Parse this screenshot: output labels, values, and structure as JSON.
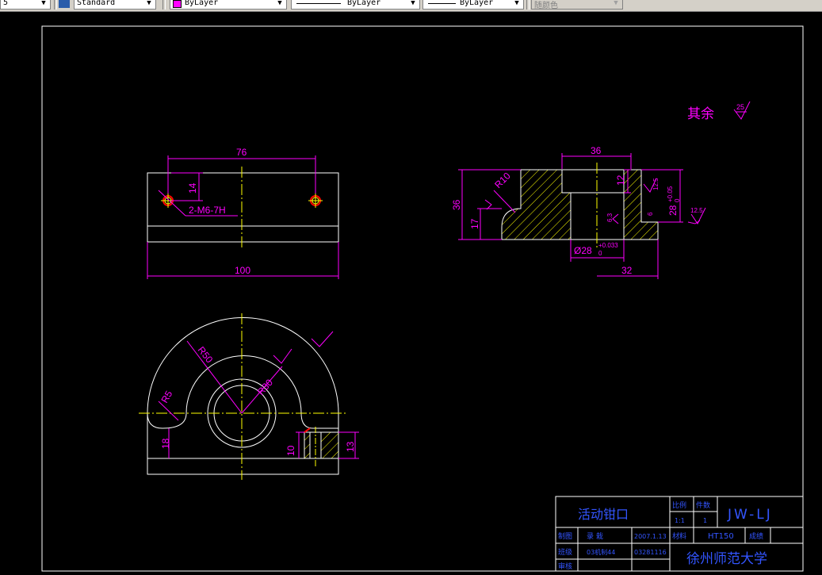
{
  "toolbar": {
    "lineweight_value": "5",
    "textstyle_value": "Standard",
    "layer_color_value": "ByLayer",
    "linetype_value": "ByLayer",
    "lineweight2_value": "ByLayer",
    "plotstyle_value": "随颜色"
  },
  "colors": {
    "background": "#000000",
    "outline": "#ffffff",
    "dimension": "#ff00ff",
    "centerline": "#ffff00",
    "hatch": "#ffff00",
    "titleblock": "#3355ff",
    "hole_marker": "#ff0000"
  },
  "drawing": {
    "surface_note": {
      "label": "其余",
      "roughness": "25"
    },
    "top_view": {
      "dim_width_total": "100",
      "dim_hole_spacing": "76",
      "dim_hole_offset": "14",
      "thread_callout": "2-M6-7H"
    },
    "section_view": {
      "dim_top_width": "36",
      "dim_bore_depth": "12",
      "dim_total_height": "36",
      "dim_step_height": "17",
      "dim_radius": "R10",
      "dim_height_tol_value": "28",
      "dim_height_tol_upper": "+0.05",
      "dim_height_tol_lower": "0",
      "dim_bore_value": "Ø28",
      "dim_bore_upper": "+0.033",
      "dim_bore_lower": "0",
      "dim_base_width": "32",
      "roughness_a": "12.5",
      "roughness_b": "6.3",
      "roughness_c": "12.5",
      "roughness_d": "6"
    },
    "front_view": {
      "dim_outer_radius": "R50",
      "dim_inner_radius": "R30",
      "dim_fillet_radius": "R5",
      "dim_base_height": "18",
      "dim_hole_depth": "10",
      "dim_hatch_height": "13"
    }
  },
  "title_block": {
    "part_name": "活动钳口",
    "scale_header": "比例",
    "count_header": "件数",
    "drawing_number": "JW-LJ",
    "scale_value": "1:1",
    "count_value": "1",
    "row_draw_label": "制图",
    "drawer_name": "录 栽",
    "draw_date": "2007.1.13",
    "material_label": "材料",
    "material_value": "HT150",
    "grade_label": "成绩",
    "class_label": "班级",
    "class_value": "03机制44",
    "student_id": "03281116",
    "review_label": "审核",
    "school_name": "徐州师范大学"
  }
}
